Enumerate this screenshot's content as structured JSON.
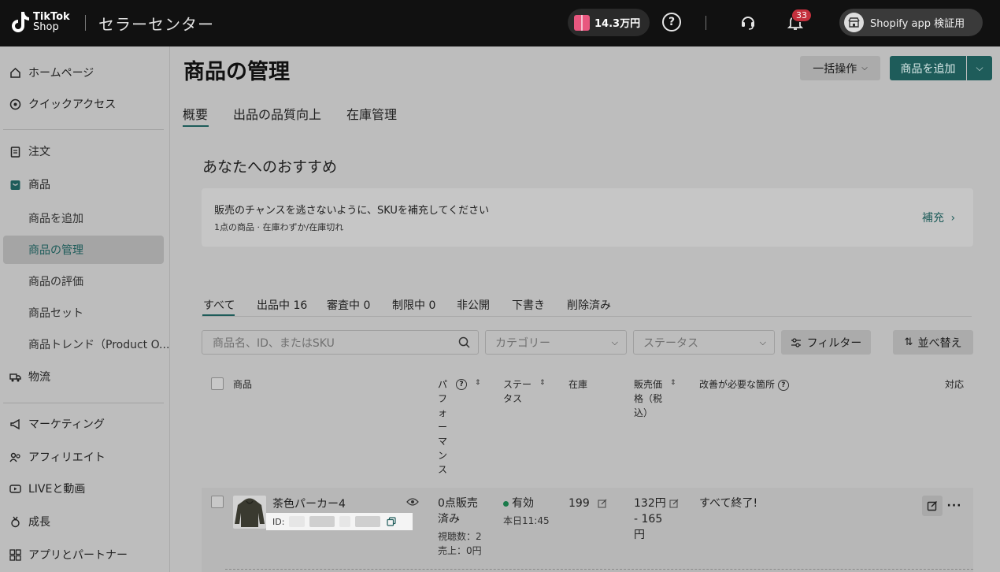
{
  "header": {
    "logo_line1": "TikTok",
    "logo_line2": "Shop",
    "title": "セラーセンター",
    "gift_amount": "14.3万円",
    "notification_count": "33",
    "shop_name": "Shopify app 検証用"
  },
  "sidebar": {
    "home": "ホームページ",
    "quick_access": "クイックアクセス",
    "orders": "注文",
    "products": "商品",
    "sub": {
      "add": "商品を追加",
      "manage": "商品の管理",
      "reviews": "商品の評価",
      "sets": "商品セット",
      "trends": "商品トレンド（Product O..."
    },
    "logistics": "物流",
    "marketing": "マーケティング",
    "affiliate": "アフィリエイト",
    "live": "LIVEと動画",
    "growth": "成長",
    "apps": "アプリとパートナー"
  },
  "main": {
    "title": "商品の管理",
    "bulk_label": "一括操作",
    "add_label": "商品を追加",
    "tabs": [
      "概要",
      "出品の品質向上",
      "在庫管理"
    ],
    "recommend_title": "あなたへのおすすめ",
    "recommend_main": "販売のチャンスを逃さないように、SKUを補充してください",
    "recommend_sub": "1点の商品 · 在庫わずか/在庫切れ",
    "recommend_link": "補充",
    "status_tabs": [
      "すべて",
      "出品中 16",
      "審査中 0",
      "制限中 0",
      "非公開",
      "下書き",
      "削除済み"
    ],
    "search_placeholder": "商品名、ID、またはSKU",
    "category_placeholder": "カテゴリー",
    "status_placeholder": "ステータス",
    "filter_label": "フィルター",
    "sort_label": "並べ替え"
  },
  "table": {
    "headers": {
      "product": "商品",
      "performance": "パフォーマンス",
      "status": "ステータス",
      "stock": "在庫",
      "price": "販売価格（税込）",
      "improvement": "改善が必要な箇所",
      "action": "対応"
    },
    "rows": [
      {
        "name": "茶色パーカー4",
        "id_label": "ID:",
        "perf_main": "0点販売済み",
        "perf_views": "視聴数：2",
        "perf_sales": "売上：0円",
        "status": "有効",
        "status_time": "本日11:45",
        "stock": "199",
        "price": "132円 - 165 円",
        "improvement": "すべて終了!"
      }
    ]
  },
  "colors": {
    "topbar": "#111111",
    "accent": "#1e5c5a",
    "badge": "#c4303d",
    "status_active": "#1a7a4a"
  }
}
